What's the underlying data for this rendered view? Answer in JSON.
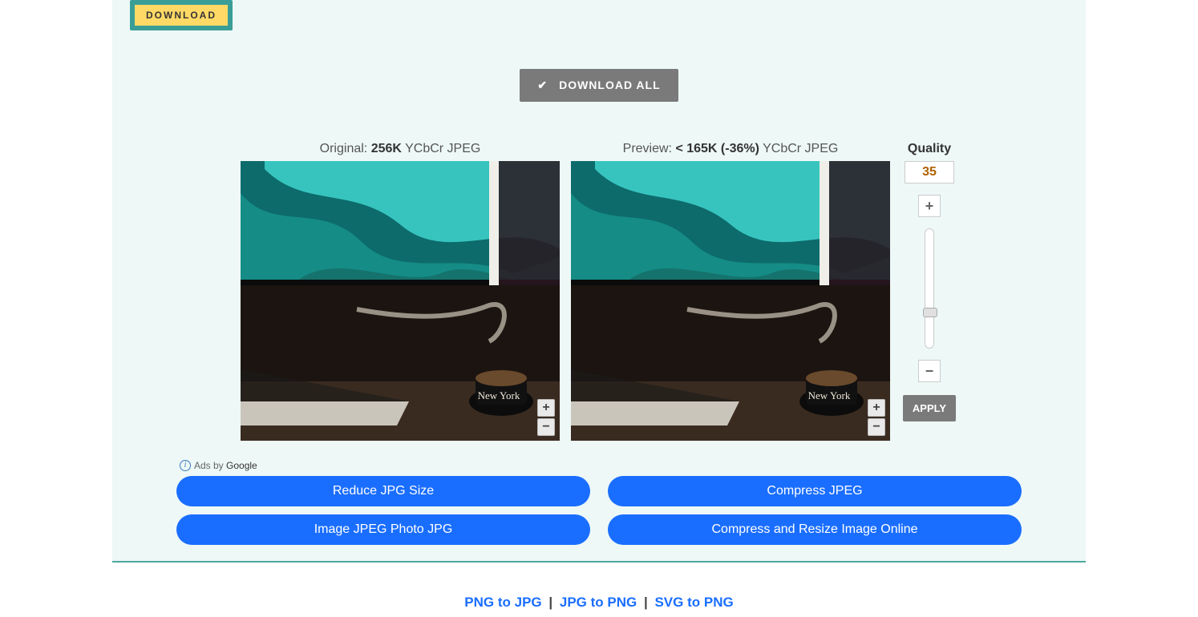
{
  "download": {
    "label": "DOWNLOAD"
  },
  "download_all": {
    "label": "DOWNLOAD ALL"
  },
  "original": {
    "prefix": "Original: ",
    "size": "256K",
    "suffix": " YCbCr JPEG"
  },
  "preview": {
    "prefix": "Preview: ",
    "size": "< 165K (-36%)",
    "suffix": " YCbCr JPEG"
  },
  "quality": {
    "title": "Quality",
    "value": "35",
    "thumb_pct": 71,
    "apply": "APPLY"
  },
  "ads": {
    "label_prefix": "Ads by ",
    "label_brand": "Google",
    "items": [
      "Reduce JPG Size",
      "Compress JPEG",
      "Image JPEG Photo JPG",
      "Compress and Resize Image Online"
    ]
  },
  "footer": {
    "links": [
      "PNG to JPG",
      "JPG to PNG",
      "SVG to PNG"
    ],
    "sep": "|"
  }
}
